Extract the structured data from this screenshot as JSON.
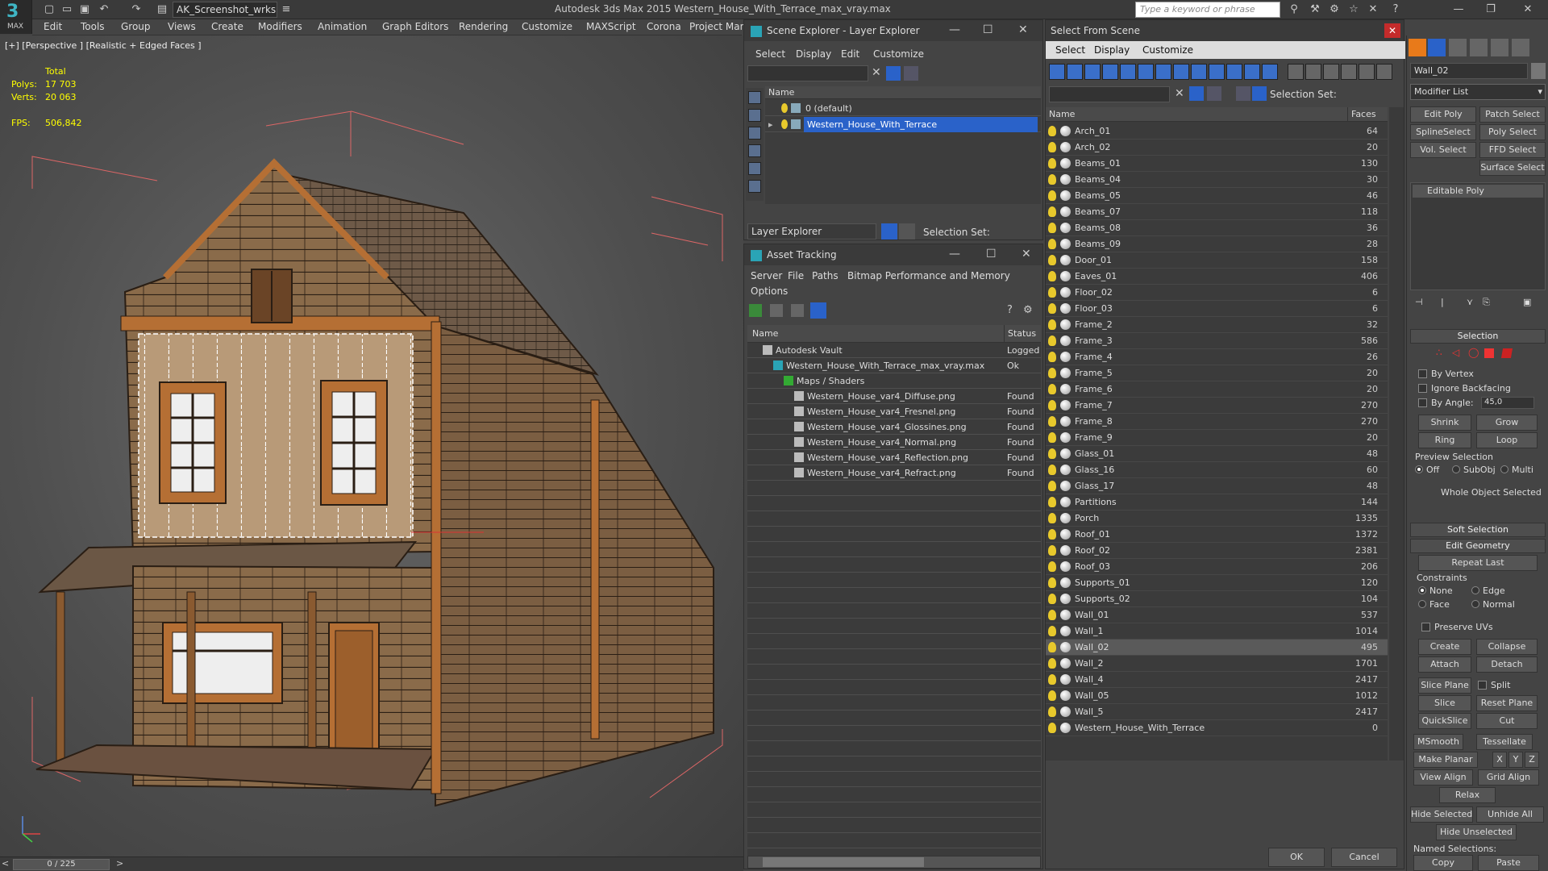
{
  "app": {
    "logo_text": "MAX",
    "title": "Autodesk 3ds Max  2015    Western_House_With_Terrace_max_vray.max",
    "workspace": "AK_Screenshot_wrksp",
    "search_placeholder": "Type a keyword or phrase",
    "menus": [
      "Edit",
      "Tools",
      "Group",
      "Views",
      "Create",
      "Modifiers",
      "Animation",
      "Graph Editors",
      "Rendering",
      "Customize",
      "MAXScript",
      "Corona",
      "Project Man"
    ]
  },
  "viewport": {
    "label": "[+] [Perspective ] [Realistic + Edged Faces ]",
    "stats": {
      "total_label": "Total",
      "polys_label": "Polys:",
      "polys": "17 703",
      "verts_label": "Verts:",
      "verts": "20 063",
      "fps_label": "FPS:",
      "fps": "506,842"
    }
  },
  "timeline": {
    "frame": "0 / 225",
    "prev": "<",
    "next": ">"
  },
  "scene_explorer": {
    "title": "Scene Explorer - Layer Explorer",
    "menus": [
      "Select",
      "Display",
      "Edit",
      "Customize"
    ],
    "column": "Name",
    "rows": [
      {
        "name": "0 (default)",
        "selected": false
      },
      {
        "name": "Western_House_With_Terrace",
        "selected": true
      }
    ],
    "footer_mode": "Layer Explorer",
    "selection_set_label": "Selection Set:"
  },
  "asset_tracking": {
    "title": "Asset Tracking",
    "menus": [
      "Server",
      "File",
      "Paths",
      "Bitmap Performance and Memory"
    ],
    "menu2": "Options",
    "columns": [
      "Name",
      "Status"
    ],
    "rows": [
      {
        "name": "Autodesk Vault",
        "status": "Logged",
        "indent": 1
      },
      {
        "name": "Western_House_With_Terrace_max_vray.max",
        "status": "Ok",
        "indent": 2
      },
      {
        "name": "Maps / Shaders",
        "status": "",
        "indent": 3
      },
      {
        "name": "Western_House_var4_Diffuse.png",
        "status": "Found",
        "indent": 4
      },
      {
        "name": "Western_House_var4_Fresnel.png",
        "status": "Found",
        "indent": 4
      },
      {
        "name": "Western_House_var4_Glossines.png",
        "status": "Found",
        "indent": 4
      },
      {
        "name": "Western_House_var4_Normal.png",
        "status": "Found",
        "indent": 4
      },
      {
        "name": "Western_House_var4_Reflection.png",
        "status": "Found",
        "indent": 4
      },
      {
        "name": "Western_House_var4_Refract.png",
        "status": "Found",
        "indent": 4
      }
    ]
  },
  "select_from_scene": {
    "title": "Select From Scene",
    "menus": [
      "Select",
      "Display",
      "Customize"
    ],
    "selection_set_label": "Selection Set:",
    "columns": [
      "Name",
      "Faces"
    ],
    "rows": [
      {
        "name": "Arch_01",
        "faces": "64"
      },
      {
        "name": "Arch_02",
        "faces": "20"
      },
      {
        "name": "Beams_01",
        "faces": "130"
      },
      {
        "name": "Beams_04",
        "faces": "30"
      },
      {
        "name": "Beams_05",
        "faces": "46"
      },
      {
        "name": "Beams_07",
        "faces": "118"
      },
      {
        "name": "Beams_08",
        "faces": "36"
      },
      {
        "name": "Beams_09",
        "faces": "28"
      },
      {
        "name": "Door_01",
        "faces": "158"
      },
      {
        "name": "Eaves_01",
        "faces": "406"
      },
      {
        "name": "Floor_02",
        "faces": "6"
      },
      {
        "name": "Floor_03",
        "faces": "6"
      },
      {
        "name": "Frame_2",
        "faces": "32"
      },
      {
        "name": "Frame_3",
        "faces": "586"
      },
      {
        "name": "Frame_4",
        "faces": "26"
      },
      {
        "name": "Frame_5",
        "faces": "20"
      },
      {
        "name": "Frame_6",
        "faces": "20"
      },
      {
        "name": "Frame_7",
        "faces": "270"
      },
      {
        "name": "Frame_8",
        "faces": "270"
      },
      {
        "name": "Frame_9",
        "faces": "20"
      },
      {
        "name": "Glass_01",
        "faces": "48"
      },
      {
        "name": "Glass_16",
        "faces": "60"
      },
      {
        "name": "Glass_17",
        "faces": "48"
      },
      {
        "name": "Partitions",
        "faces": "144"
      },
      {
        "name": "Porch",
        "faces": "1335"
      },
      {
        "name": "Roof_01",
        "faces": "1372"
      },
      {
        "name": "Roof_02",
        "faces": "2381"
      },
      {
        "name": "Roof_03",
        "faces": "206"
      },
      {
        "name": "Supports_01",
        "faces": "120"
      },
      {
        "name": "Supports_02",
        "faces": "104"
      },
      {
        "name": "Wall_01",
        "faces": "537"
      },
      {
        "name": "Wall_1",
        "faces": "1014"
      },
      {
        "name": "Wall_02",
        "faces": "495",
        "highlight": true
      },
      {
        "name": "Wall_2",
        "faces": "1701"
      },
      {
        "name": "Wall_4",
        "faces": "2417"
      },
      {
        "name": "Wall_05",
        "faces": "1012"
      },
      {
        "name": "Wall_5",
        "faces": "2417"
      },
      {
        "name": "Western_House_With_Terrace",
        "faces": "0"
      }
    ],
    "ok": "OK",
    "cancel": "Cancel"
  },
  "command_panel": {
    "object_name": "Wall_02",
    "modifier_list": "Modifier List",
    "mod_buttons": [
      "Edit Poly",
      "Patch Select",
      "SplineSelect",
      "Poly Select",
      "Vol. Select",
      "FFD Select",
      "Surface Select"
    ],
    "stack_item": "Editable Poly",
    "selection": {
      "header": "Selection",
      "by_vertex": "By Vertex",
      "ignore_backfacing": "Ignore Backfacing",
      "by_angle": "By Angle:",
      "angle_value": "45,0",
      "shrink": "Shrink",
      "grow": "Grow",
      "ring": "Ring",
      "loop": "Loop",
      "preview_label": "Preview Selection",
      "preview_off": "Off",
      "preview_subobj": "SubObj",
      "preview_multi": "Multi",
      "status": "Whole Object Selected"
    },
    "soft_selection": "Soft Selection",
    "edit_geometry": {
      "header": "Edit Geometry",
      "repeat_last": "Repeat Last",
      "constraints": "Constraints",
      "none": "None",
      "edge": "Edge",
      "face": "Face",
      "normal": "Normal",
      "preserve_uvs": "Preserve UVs",
      "create": "Create",
      "collapse": "Collapse",
      "attach": "Attach",
      "detach": "Detach",
      "slice_plane": "Slice Plane",
      "split": "Split",
      "slice": "Slice",
      "reset_plane": "Reset Plane",
      "quickslice": "QuickSlice",
      "cut": "Cut",
      "msmooth": "MSmooth",
      "tessellate": "Tessellate",
      "make_planar": "Make Planar",
      "x": "X",
      "y": "Y",
      "z": "Z",
      "view_align": "View Align",
      "grid_align": "Grid Align",
      "relax": "Relax",
      "hide_selected": "Hide Selected",
      "unhide_all": "Unhide All",
      "hide_unselected": "Hide Unselected",
      "named_selections": "Named Selections:",
      "copy": "Copy",
      "paste": "Paste"
    }
  }
}
